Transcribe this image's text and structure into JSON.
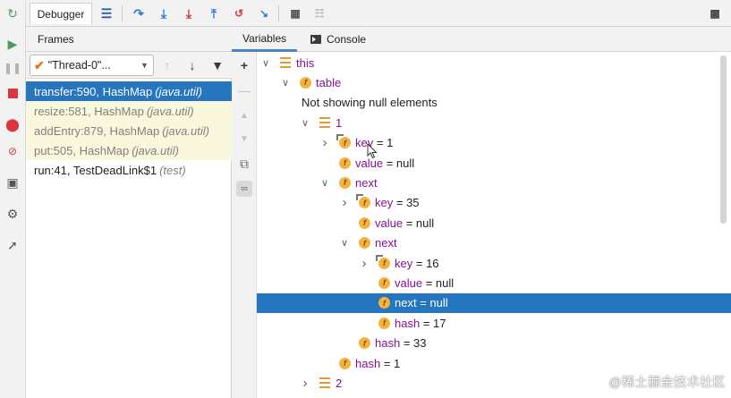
{
  "toolbar": {
    "tab_label": "Debugger"
  },
  "frames_panel": {
    "title": "Frames",
    "thread": {
      "label": "\"Thread-0\"...",
      "status": "suspended"
    },
    "frames": [
      {
        "method": "transfer:590, HashMap",
        "package": "(java.util)",
        "state": "selected"
      },
      {
        "method": "resize:581, HashMap",
        "package": "(java.util)",
        "state": "library"
      },
      {
        "method": "addEntry:879, HashMap",
        "package": "(java.util)",
        "state": "library"
      },
      {
        "method": "put:505, HashMap",
        "package": "(java.util)",
        "state": "library"
      },
      {
        "method": "run:41, TestDeadLink$1",
        "package": "(test)",
        "state": "user"
      }
    ]
  },
  "variables_panel": {
    "tabs": [
      {
        "label": "Variables",
        "active": true
      },
      {
        "label": "Console",
        "active": false
      }
    ],
    "rows": [
      {
        "depth": 0,
        "expand": "expanded",
        "icon": "array",
        "name": "this",
        "eq": "",
        "value": ""
      },
      {
        "depth": 1,
        "expand": "expanded",
        "icon": "field",
        "name": "table",
        "eq": "",
        "value": ""
      },
      {
        "depth": 2,
        "expand": "none",
        "icon": "none",
        "name": "",
        "eq": "",
        "value": "Not showing null elements"
      },
      {
        "depth": 2,
        "expand": "expanded",
        "icon": "array",
        "name": "1",
        "eq": "",
        "value": ""
      },
      {
        "depth": 3,
        "expand": "collapsed",
        "icon": "field-final",
        "name": "key",
        "eq": " = ",
        "value": "1"
      },
      {
        "depth": 3,
        "expand": "none",
        "icon": "field",
        "name": "value",
        "eq": " = ",
        "value": "null"
      },
      {
        "depth": 3,
        "expand": "expanded",
        "icon": "field",
        "name": "next",
        "eq": "",
        "value": ""
      },
      {
        "depth": 4,
        "expand": "collapsed",
        "icon": "field-final",
        "name": "key",
        "eq": " = ",
        "value": "35"
      },
      {
        "depth": 4,
        "expand": "none",
        "icon": "field",
        "name": "value",
        "eq": " = ",
        "value": "null"
      },
      {
        "depth": 4,
        "expand": "expanded",
        "icon": "field",
        "name": "next",
        "eq": "",
        "value": ""
      },
      {
        "depth": 5,
        "expand": "collapsed",
        "icon": "field-final",
        "name": "key",
        "eq": " = ",
        "value": "16"
      },
      {
        "depth": 5,
        "expand": "none",
        "icon": "field",
        "name": "value",
        "eq": " = ",
        "value": "null"
      },
      {
        "depth": 5,
        "expand": "none",
        "icon": "field",
        "name": "next",
        "eq": " = ",
        "value": "null",
        "selected": true
      },
      {
        "depth": 5,
        "expand": "none",
        "icon": "field",
        "name": "hash",
        "eq": " = ",
        "value": "17"
      },
      {
        "depth": 4,
        "expand": "none",
        "icon": "field",
        "name": "hash",
        "eq": " = ",
        "value": "33"
      },
      {
        "depth": 3,
        "expand": "none",
        "icon": "field",
        "name": "hash",
        "eq": " = ",
        "value": "1"
      },
      {
        "depth": 2,
        "expand": "collapsed",
        "icon": "array",
        "name": "2",
        "eq": "",
        "value": ""
      }
    ]
  },
  "watermark": "@稀土掘金技术社区",
  "colors": {
    "selection": "#2675bf",
    "field_name": "#871094",
    "field_icon": "#f3b33f",
    "library_frame_bg": "#fbf7dc"
  }
}
